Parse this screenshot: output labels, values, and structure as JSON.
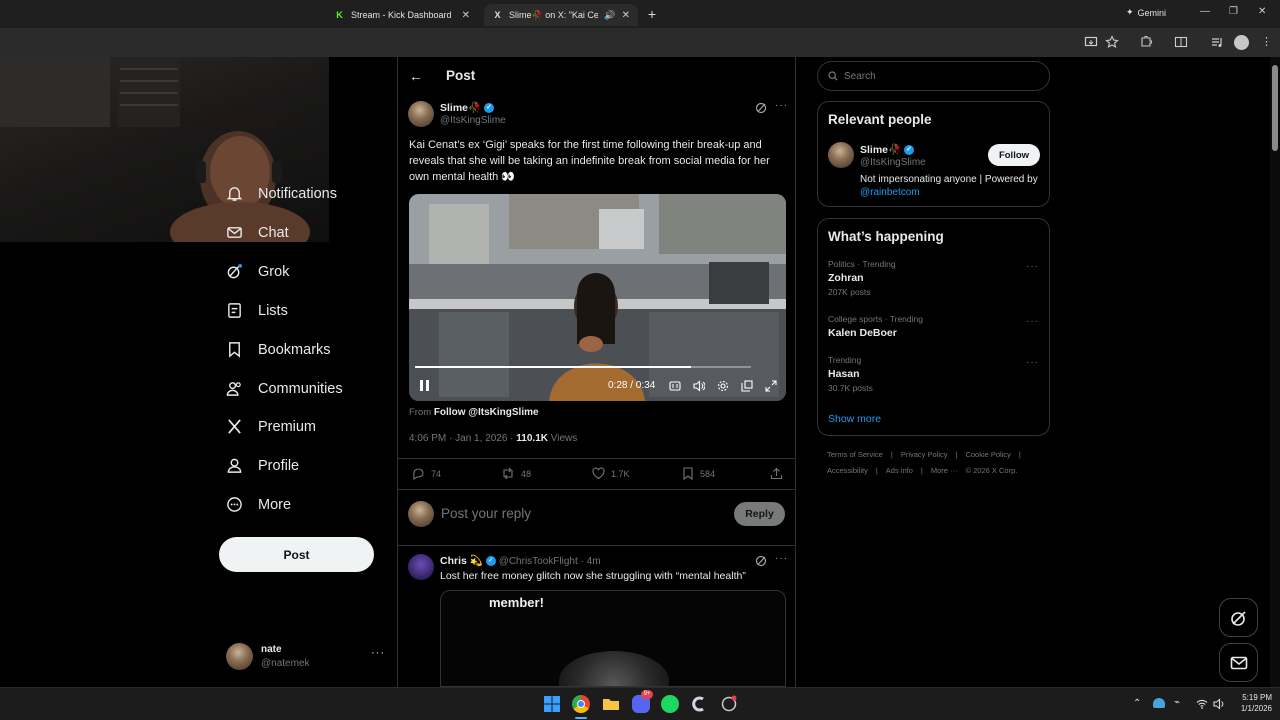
{
  "browser": {
    "tabs": [
      {
        "title": "Stream - Kick Dashboard",
        "favicon": "K"
      },
      {
        "title": "Slime🥀 on X: \"Kai Cenat's",
        "favicon": "X"
      }
    ],
    "new_tab": "+",
    "gemini_label": "Gemini"
  },
  "nav": {
    "items": [
      {
        "label": "Notifications",
        "icon": "bell-icon"
      },
      {
        "label": "Chat",
        "icon": "mail-icon"
      },
      {
        "label": "Grok",
        "icon": "grok-icon"
      },
      {
        "label": "Lists",
        "icon": "list-icon"
      },
      {
        "label": "Bookmarks",
        "icon": "bookmark-icon"
      },
      {
        "label": "Communities",
        "icon": "people-icon"
      },
      {
        "label": "Premium",
        "icon": "x-logo-icon"
      },
      {
        "label": "Profile",
        "icon": "user-icon"
      },
      {
        "label": "More",
        "icon": "more-circle-icon"
      }
    ],
    "post_button": "Post",
    "account": {
      "name": "nate",
      "handle": "@natemek"
    }
  },
  "main": {
    "header_title": "Post",
    "post": {
      "author_name": "Slime🥀",
      "author_handle": "@ItsKingSlime",
      "text": "Kai Cenat’s ex ‘Gigi’ speaks for the first time following their break-up and reveals that she will be taking an indefinite break from social media for her own mental health 👀",
      "video_time": "0:28 / 0:34",
      "video_progress": 0.82,
      "from_prefix": "From",
      "from_follow": "Follow @ItsKingSlime",
      "timestamp": "4:06 PM · Jan 1, 2026 ·",
      "views_count": "110.1K",
      "views_label": "Views",
      "replies": "74",
      "reposts": "48",
      "likes": "1.7K",
      "bookmarks": "584"
    },
    "reply_box": {
      "placeholder": "Post your reply",
      "button": "Reply"
    },
    "reply": {
      "author_name": "Chris 💫",
      "author_handle": "@ChrisTookFlight · 4m",
      "text": "Lost her free money glitch now she struggling with “mental health”",
      "media_text": "member!"
    }
  },
  "sidebar": {
    "search_placeholder": "Search",
    "relevant": {
      "title": "Relevant people",
      "name": "Slime🥀",
      "handle": "@ItsKingSlime",
      "follow": "Follow",
      "bio_prefix": "Not impersonating anyone | Powered by",
      "bio_link": "@rainbetcom"
    },
    "happening": {
      "title": "What’s happening",
      "trends": [
        {
          "meta": "Politics · Trending",
          "name": "Zohran",
          "count": "207K posts"
        },
        {
          "meta": "College sports · Trending",
          "name": "Kalen DeBoer",
          "count": ""
        },
        {
          "meta": "Trending",
          "name": "Hasan",
          "count": "30.7K posts"
        }
      ],
      "show_more": "Show more"
    },
    "footer": {
      "line1": [
        "Terms of Service",
        "Privacy Policy",
        "Cookie Policy"
      ],
      "line2": [
        "Accessibility",
        "Ads info",
        "More ···",
        "© 2026 X Corp."
      ]
    }
  },
  "taskbar": {
    "time": "5:19 PM",
    "date": "1/1/2026",
    "discord_badge": "9+"
  },
  "colors": {
    "accent": "#1d9bf0",
    "background": "#000000",
    "text": "#e7e9ea",
    "muted": "#71767b",
    "border": "#2f3336"
  }
}
